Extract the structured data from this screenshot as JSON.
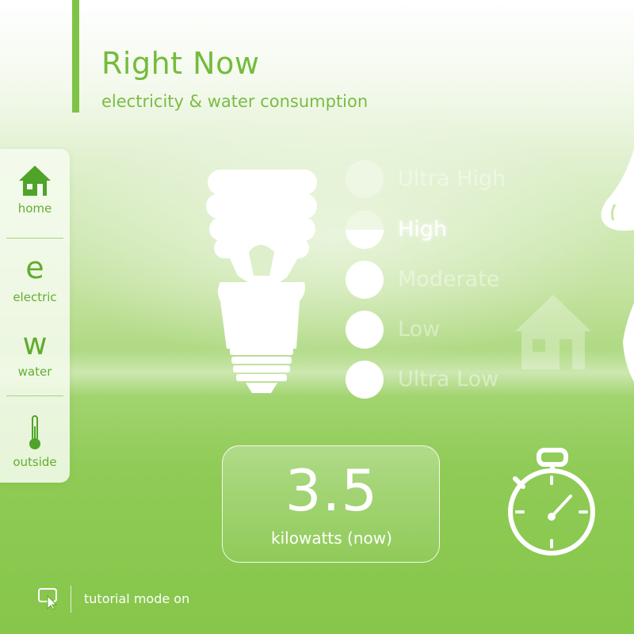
{
  "header": {
    "title": "Right Now",
    "subtitle": "electricity & water consumption"
  },
  "sidebar": {
    "items": [
      {
        "label": "home",
        "icon": "house-icon"
      },
      {
        "label": "electric",
        "glyph": "e"
      },
      {
        "label": "water",
        "glyph": "w"
      },
      {
        "label": "outside",
        "icon": "thermometer-icon"
      }
    ]
  },
  "levels": [
    {
      "label": "Ultra High",
      "state": "inactive"
    },
    {
      "label": "High",
      "state": "current"
    },
    {
      "label": "Moderate",
      "state": "filled"
    },
    {
      "label": "Low",
      "state": "filled"
    },
    {
      "label": "Ultra Low",
      "state": "filled"
    }
  ],
  "reading": {
    "value": "3.5",
    "unit": "kilowatts (now)"
  },
  "footer": {
    "tutorial_text": "tutorial mode on"
  },
  "icons": {
    "main": "lightbulb-icon",
    "right_top": "water-drop-icon",
    "right_mid": "water-drop-icon",
    "background": "house-icon",
    "timer": "stopwatch-icon",
    "tutorial": "screen-cursor-icon"
  },
  "colors": {
    "accent": "#7fc346",
    "nav_text": "#64ad30",
    "background_top": "#ffffff",
    "background_bottom": "#86c64a"
  }
}
